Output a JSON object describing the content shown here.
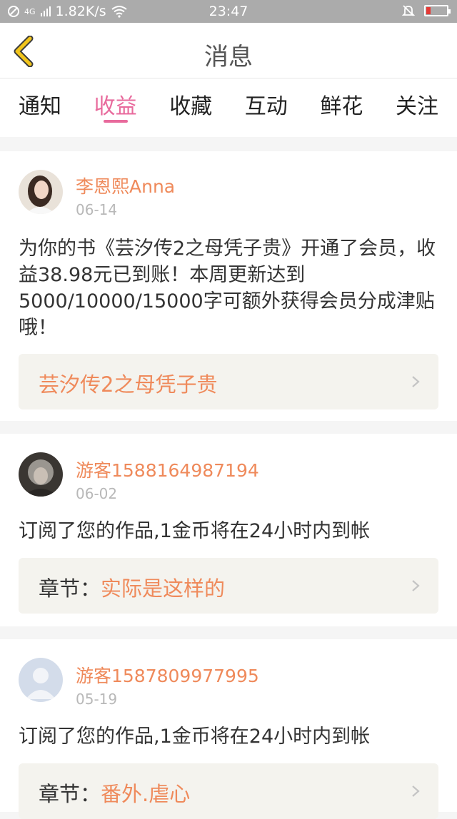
{
  "status_bar": {
    "network": "4G",
    "speed": "1.82K/s",
    "time": "23:47"
  },
  "header": {
    "title": "消息"
  },
  "tabs": [
    {
      "label": "通知",
      "active": false
    },
    {
      "label": "收益",
      "active": true
    },
    {
      "label": "收藏",
      "active": false
    },
    {
      "label": "互动",
      "active": false
    },
    {
      "label": "鲜花",
      "active": false
    },
    {
      "label": "关注",
      "active": false
    }
  ],
  "messages": [
    {
      "user": "李恩熙Anna",
      "date": "06-14",
      "text": "为你的书《芸汐传2之母凭子贵》开通了会员，收益38.98元已到账！本周更新达到5000/10000/15000字可额外获得会员分成津贴哦！",
      "link_prefix": "",
      "link": "芸汐传2之母凭子贵"
    },
    {
      "user": "游客1588164987194",
      "date": "06-02",
      "text": "订阅了您的作品,1金币将在24小时内到帐",
      "link_prefix": "章节：",
      "link": "实际是这样的"
    },
    {
      "user": "游客1587809977995",
      "date": "05-19",
      "text": "订阅了您的作品,1金币将在24小时内到帐",
      "link_prefix": "章节：",
      "link": "番外.虐心"
    }
  ],
  "colors": {
    "accent_pink": "#e86a9c",
    "accent_orange": "#ef8a5b",
    "back_arrow": "#f2c51b"
  }
}
